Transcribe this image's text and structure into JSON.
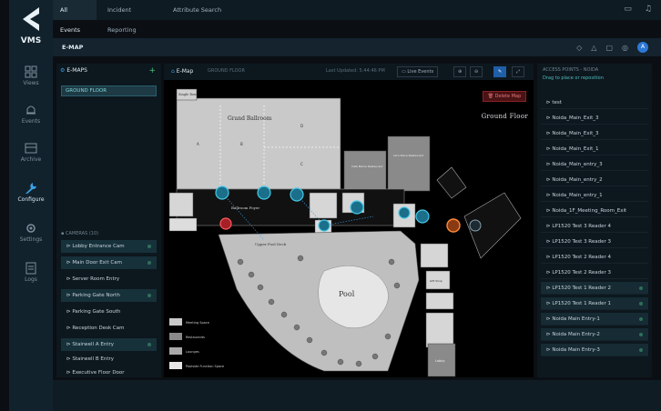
{
  "app": {
    "brand": "VMS"
  },
  "rail": [
    {
      "label": "Views",
      "icon": "grid-icon"
    },
    {
      "label": "Events",
      "icon": "bell-icon"
    },
    {
      "label": "Archive",
      "icon": "archive-icon"
    },
    {
      "label": "Configure",
      "icon": "wrench-icon",
      "active": true
    },
    {
      "label": "Settings",
      "icon": "gear-icon"
    },
    {
      "label": "Logs",
      "icon": "log-icon"
    }
  ],
  "tabs": [
    "All Events",
    "Incident Reporting",
    "Attribute Search"
  ],
  "header": {
    "title": "E-MAP"
  },
  "left_panel": {
    "emaps_title": "E-MAPS",
    "floor": "GROUND FLOOR",
    "cameras_title": "CAMERAS (10)",
    "cameras": [
      "Lobby Entrance Cam",
      "Main Door Exit Cam",
      "Server Room Entry",
      "Parking Gate North",
      "Parking Gate South",
      "Reception Desk Cam",
      "Stairwell A Entry",
      "Stairwell B Entry",
      "Executive Floor Door"
    ]
  },
  "map": {
    "title": "E-Map",
    "subtitle": "GROUND FLOOR",
    "updated": "Last Updated: 5:44:46 PM",
    "live_events": "Live Events",
    "delete_label": "Delete Map",
    "floor_label": "Ground Floor",
    "rooms": {
      "single": "Single Row",
      "grand": "Grand Ballroom",
      "a": "A",
      "b": "B",
      "c": "C",
      "d": "D",
      "cafe": "Cafe Mama Restaurant",
      "lasi": "Lai's Place Restaurant",
      "ballroom_foyer": "Ballroom Foyer",
      "upper_pool": "Upper Pool Deck",
      "pool": "Pool",
      "gift": "Gift Shop",
      "lobby": "Lobby"
    },
    "legend": [
      "Meeting Space",
      "Restaurants",
      "Lounges",
      "Poolside Function Space"
    ]
  },
  "right_panel": {
    "title": "ACCESS POINTS - NOIDA",
    "hint": "Drag to place or reposition",
    "items": [
      {
        "label": "test"
      },
      {
        "label": "Noida_Main_Exit_3"
      },
      {
        "label": "Noida_Main_Exit_3"
      },
      {
        "label": "Noida_Main_Exit_1"
      },
      {
        "label": "Noida_Main_entry_3"
      },
      {
        "label": "Noida_Main_entry_2"
      },
      {
        "label": "Noida_Main_entry_1"
      },
      {
        "label": "Noida_1F_Meeting_Room_Exit"
      },
      {
        "label": "LP1520 Test 3 Reader 4"
      },
      {
        "label": "LP1520 Test 3 Reader 3"
      },
      {
        "label": "LP1520 Test 2 Reader 4"
      },
      {
        "label": "LP1520 Test 2 Reader 3"
      },
      {
        "label": "LP1520 Test 1 Reader 2",
        "selected": true
      },
      {
        "label": "LP1520 Test 1 Reader 1",
        "selected": true
      },
      {
        "label": "Noida Main Entry-1",
        "selected": true
      },
      {
        "label": "Noida Main Entry-2",
        "selected": true
      },
      {
        "label": "Noida Main Entry-3",
        "selected": true
      }
    ]
  }
}
